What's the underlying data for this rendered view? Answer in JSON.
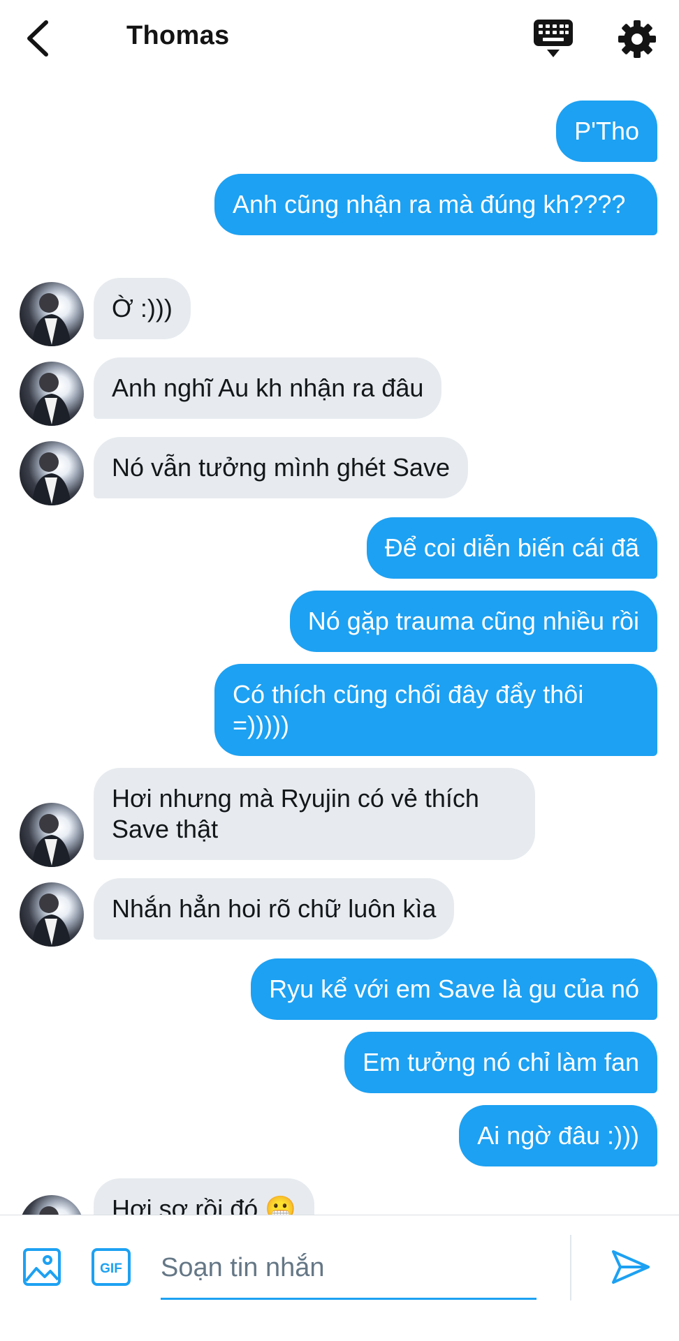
{
  "header": {
    "title": "Thomas",
    "back_icon": "chevron-left-icon",
    "keyboard_icon": "keyboard-icon",
    "settings_icon": "gear-icon"
  },
  "colors": {
    "outgoing_bubble": "#1da1f2",
    "incoming_bubble": "#e7ebef",
    "accent": "#1da1f2"
  },
  "messages": [
    {
      "dir": "out",
      "text": "P'Tho"
    },
    {
      "dir": "out",
      "text": "Anh cũng nhận ra mà đúng kh????"
    },
    {
      "dir": "in",
      "text": "Ờ :)))"
    },
    {
      "dir": "in",
      "text": "Anh nghĩ Au kh nhận ra đâu"
    },
    {
      "dir": "in",
      "text": "Nó vẫn tưởng mình ghét Save"
    },
    {
      "dir": "out",
      "text": "Để coi diễn biến cái đã"
    },
    {
      "dir": "out",
      "text": "Nó gặp trauma cũng nhiều rồi"
    },
    {
      "dir": "out",
      "text": "Có thích cũng chối đây đẩy thôi =)))))"
    },
    {
      "dir": "in",
      "text": "Hơi nhưng mà Ryujin có vẻ thích Save thật"
    },
    {
      "dir": "in",
      "text": "Nhắn hẳn hoi rõ chữ luôn kìa"
    },
    {
      "dir": "out",
      "text": "Ryu kể với em Save là gu của nó"
    },
    {
      "dir": "out",
      "text": "Em tưởng nó chỉ làm fan"
    },
    {
      "dir": "out",
      "text": "Ai ngờ đâu :)))"
    },
    {
      "dir": "in",
      "text": "Hơi sợ rồi đó 😬"
    }
  ],
  "composer": {
    "placeholder": "Soạn tin nhắn",
    "value": "",
    "image_icon": "image-icon",
    "gif_label": "GIF",
    "send_icon": "send-icon"
  }
}
